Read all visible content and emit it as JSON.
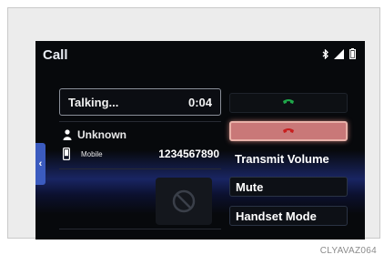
{
  "header": {
    "title": "Call"
  },
  "call": {
    "status": "Talking...",
    "duration": "0:04",
    "contact_name": "Unknown",
    "phone_type": "Mobile",
    "phone_number": "1234567890"
  },
  "actions": {
    "transmit_volume": "Transmit Volume",
    "mute": "Mute",
    "handset_mode": "Handset Mode"
  },
  "caption": "CLYAVAZ064",
  "icons": {
    "status": [
      "bluetooth-icon",
      "signal-icon",
      "battery-icon"
    ],
    "answer": "phone-answer-icon",
    "hangup": "phone-hangup-icon",
    "keypad": "disabled-icon"
  },
  "colors": {
    "screen_bg": "#07090c",
    "answer_green": "#1fa84a",
    "hangup_red": "#c97878"
  }
}
